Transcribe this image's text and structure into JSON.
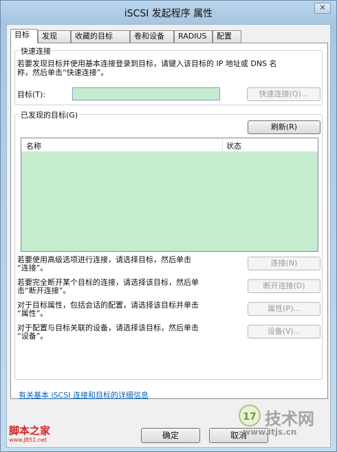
{
  "window": {
    "title": "iSCSI 发起程序 属性",
    "close_icon": "✕"
  },
  "tabs": [
    {
      "label": "目标",
      "active": true
    },
    {
      "label": "发现"
    },
    {
      "label": "收藏的目标"
    },
    {
      "label": "卷和设备"
    },
    {
      "label": "RADIUS"
    },
    {
      "label": "配置"
    }
  ],
  "quick_connect": {
    "title": "快速连接",
    "description_line1": "若要发现目标并使用基本连接登录到目标，请键入该目标的 IP 地址或 DNS 名",
    "description_line2": "称，然后单击“快速连接”。",
    "target_label": "目标(T):",
    "target_value": "",
    "button_label": "快速连接(Q)..."
  },
  "discovered": {
    "title": "已发现的目标(G)",
    "refresh_label": "刷新(R)",
    "columns": [
      "名称",
      "状态"
    ],
    "rows": []
  },
  "actions": [
    {
      "line1": "若要使用高级选项进行连接，请选择目标，然后单击",
      "line2": "“连接”。",
      "button": "连接(N)"
    },
    {
      "line1": "若要完全断开某个目标的连接，请选择该目标，然后单",
      "line2": "击“断开连接”。",
      "button": "断开连接(D)"
    },
    {
      "line1": "对于目标属性，包括会话的配置，请选择该目标并单击",
      "line2": "“属性”。",
      "button": "属性(P)..."
    },
    {
      "line1": "对于配置与目标关联的设备，请选择该目标，然后单击",
      "line2": "“设备”。",
      "button": "设备(V)..."
    }
  ],
  "help_link": "有关基本 iSCSI 连接和目标的详细信息",
  "footer": {
    "ok": "确定",
    "cancel": "取消"
  },
  "watermarks": {
    "left_text": "脚本之家",
    "left_url": "www.JB51.net",
    "right_logo": "17",
    "right_text": "技术网",
    "right_url": "www.itjs.cn"
  },
  "colors": {
    "list_bg": "#c6ecd0",
    "link": "#0b5fb3",
    "watermark_red": "#d82020"
  }
}
